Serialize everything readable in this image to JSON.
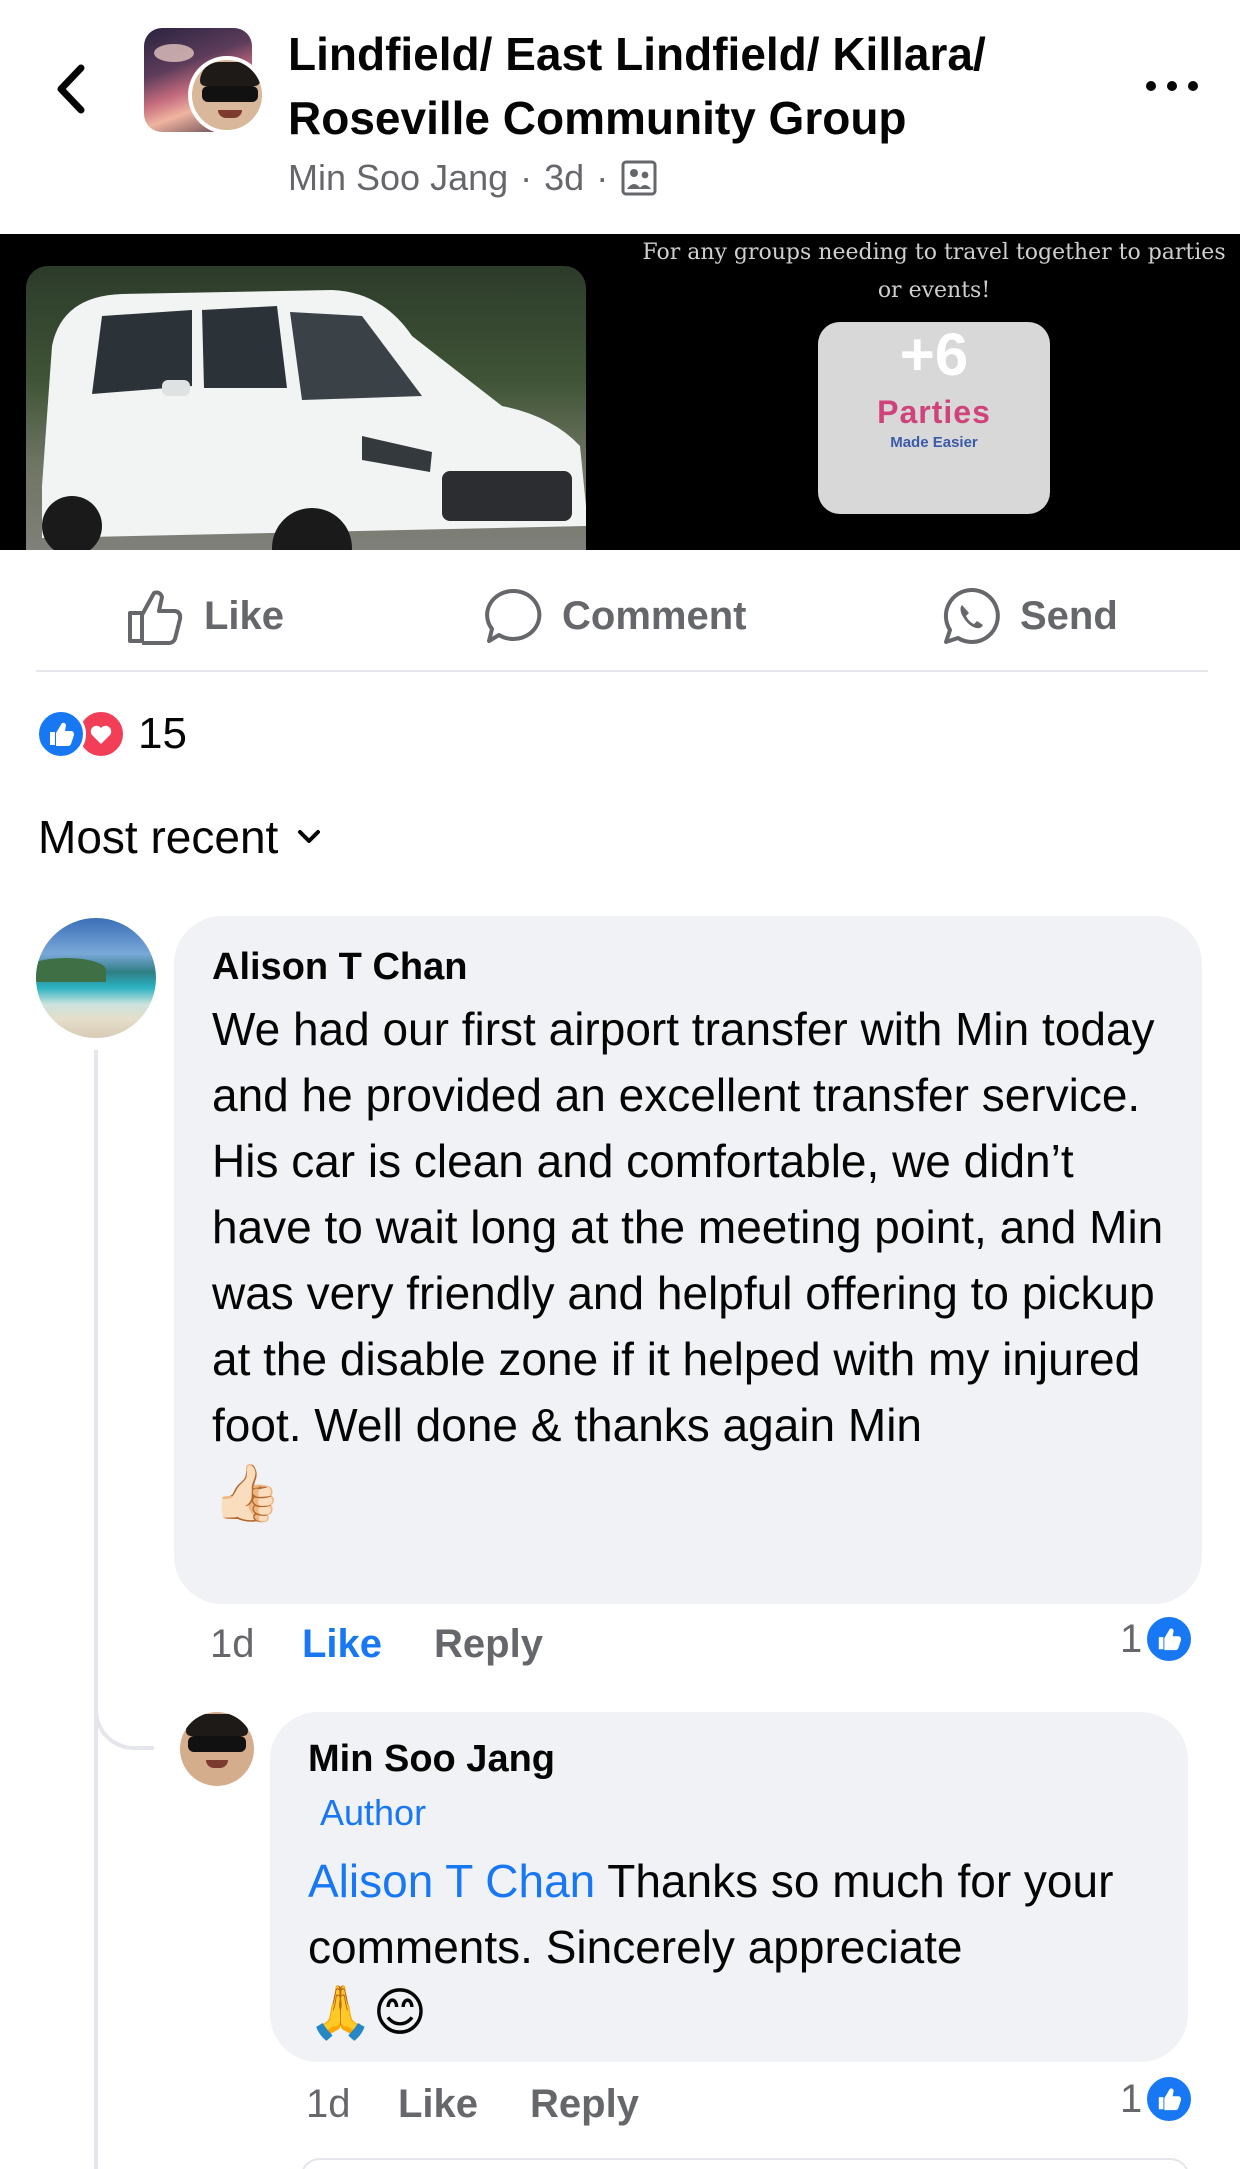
{
  "header": {
    "title": "Lindfield/ East Lindfield/ Killara/\nRoseville  Community Group",
    "author": "Min Soo Jang",
    "time": "3d",
    "icons": [
      "back-icon",
      "more-icon",
      "group-audience-icon"
    ]
  },
  "media": {
    "promo_text": "For any groups needing to travel together to parties or events!",
    "more_count": "+6",
    "logo_text": "Parties",
    "logo_sub": "Made Easier"
  },
  "actions": {
    "like": "Like",
    "comment": "Comment",
    "send": "Send"
  },
  "reactions": {
    "count": "15",
    "types": [
      "like",
      "love"
    ],
    "colors": {
      "like": "#1877f2",
      "love": "#f33e58"
    }
  },
  "sort": {
    "label": "Most recent"
  },
  "comments": [
    {
      "author": "Alison T Chan",
      "text": "We had our first airport transfer with Min today and he provided an excellent transfer service. His car is clean and comfortable, we didn’t have to wait long at the meeting point, and Min was very friendly and helpful offering to pickup at the disable zone if it helped with my injured foot. Well done & thanks again Min",
      "emoji": "👍🏻",
      "time": "1d",
      "like": "Like",
      "reply": "Reply",
      "like_count": "1"
    },
    {
      "author": "Min Soo Jang",
      "badge": "Author",
      "mention": "Alison T Chan",
      "text": " Thanks so much for your comments. Sincerely appreciate",
      "emoji": "🙏😊",
      "time": "1d",
      "like": "Like",
      "reply": "Reply",
      "like_count": "1"
    }
  ],
  "colors": {
    "accent": "#1877f2",
    "secondary_text": "#65676b",
    "bubble": "#f0f2f5"
  }
}
